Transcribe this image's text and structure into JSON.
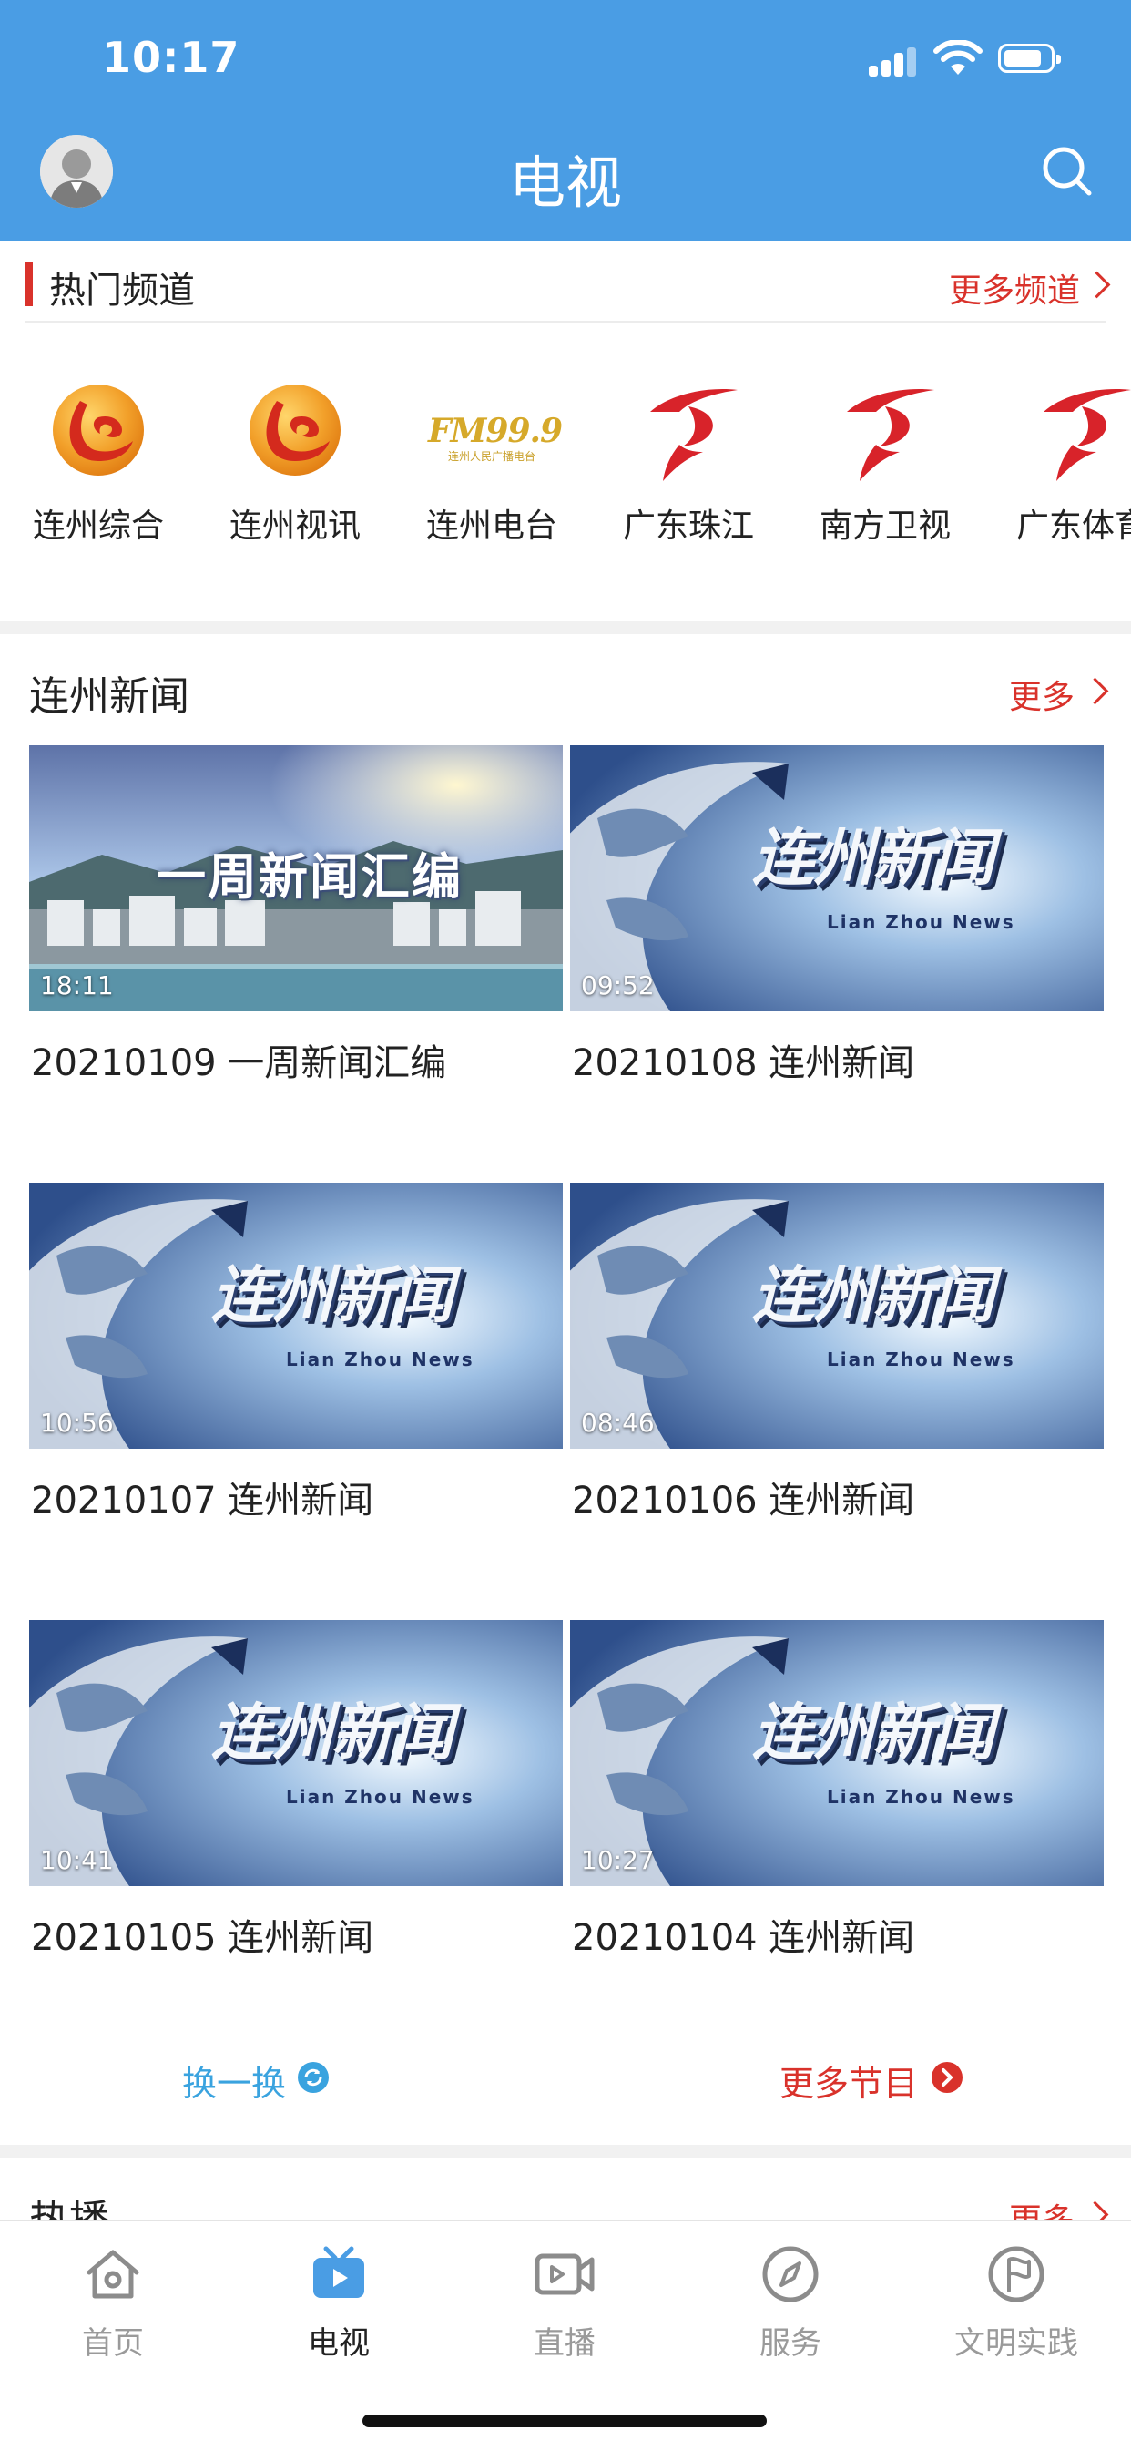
{
  "status_bar": {
    "time": "10:17"
  },
  "header": {
    "title": "电视"
  },
  "hot_channels": {
    "title": "热门频道",
    "more_label": "更多频道",
    "channels": [
      {
        "name": "连州综合",
        "logo": "lianzhou-logo"
      },
      {
        "name": "连州视讯",
        "logo": "lianzhou-logo"
      },
      {
        "name": "连州电台",
        "logo": "fm-logo",
        "logo_text": "FM99.9",
        "logo_subtext": "连州人民广播电台"
      },
      {
        "name": "广东珠江",
        "logo": "gdtv-logo"
      },
      {
        "name": "南方卫视",
        "logo": "gdtv-logo"
      },
      {
        "name": "广东体育",
        "logo": "gdtv-logo"
      }
    ]
  },
  "lianzhou_news": {
    "title": "连州新闻",
    "more_label": "更多",
    "items": [
      {
        "title": "20210109 一周新闻汇编",
        "duration": "18:11",
        "thumb": "weekly",
        "thumb_text": "一周新闻汇编"
      },
      {
        "title": "20210108 连州新闻",
        "duration": "09:52",
        "thumb": "news",
        "thumb_text": "连州新闻",
        "thumb_subtext": "Lian Zhou News"
      },
      {
        "title": "20210107 连州新闻",
        "duration": "10:56",
        "thumb": "news",
        "thumb_text": "连州新闻",
        "thumb_subtext": "Lian Zhou News"
      },
      {
        "title": "20210106 连州新闻",
        "duration": "08:46",
        "thumb": "news",
        "thumb_text": "连州新闻",
        "thumb_subtext": "Lian Zhou News"
      },
      {
        "title": "20210105 连州新闻",
        "duration": "10:41",
        "thumb": "news",
        "thumb_text": "连州新闻",
        "thumb_subtext": "Lian Zhou News"
      },
      {
        "title": "20210104 连州新闻",
        "duration": "10:27",
        "thumb": "news",
        "thumb_text": "连州新闻",
        "thumb_subtext": "Lian Zhou News"
      }
    ],
    "refresh_label": "换一换",
    "more_programs_label": "更多节目"
  },
  "hot_section": {
    "title": "热播",
    "more_label": "更多"
  },
  "tabbar": {
    "tabs": [
      {
        "label": "首页",
        "icon": "home-icon",
        "active": false
      },
      {
        "label": "电视",
        "icon": "tv-icon",
        "active": true
      },
      {
        "label": "直播",
        "icon": "live-video-icon",
        "active": false
      },
      {
        "label": "服务",
        "icon": "compass-icon",
        "active": false
      },
      {
        "label": "文明实践",
        "icon": "flag-circle-icon",
        "active": false
      }
    ]
  },
  "colors": {
    "header_bg": "#4a9de4",
    "accent_red": "#d9322b",
    "accent_blue": "#3aa3df",
    "tab_active": "#4a9de4",
    "tab_inactive": "#9a9a9a"
  }
}
